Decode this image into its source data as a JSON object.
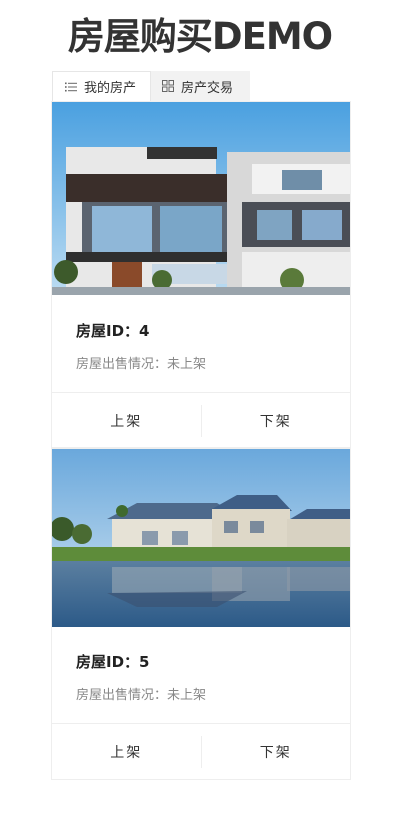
{
  "header": {
    "title": "房屋购买DEMO"
  },
  "tabs": [
    {
      "label": "我的房产",
      "icon": "list-icon",
      "active": true
    },
    {
      "label": "房产交易",
      "icon": "grid-icon",
      "active": false
    }
  ],
  "houses": [
    {
      "id_label": "房屋ID：4",
      "status_label": "房屋出售情况：未上架",
      "photo": "modern-villa-photo",
      "list_button": "上架",
      "unlist_button": "下架"
    },
    {
      "id_label": "房屋ID：5",
      "status_label": "房屋出售情况：未上架",
      "photo": "lakeside-houses-photo",
      "list_button": "上架",
      "unlist_button": "下架"
    }
  ],
  "colors": {
    "title": "#333333",
    "secondary_text": "#888888",
    "border": "#eeeeee",
    "tab_bar": "#f2f2f2"
  }
}
